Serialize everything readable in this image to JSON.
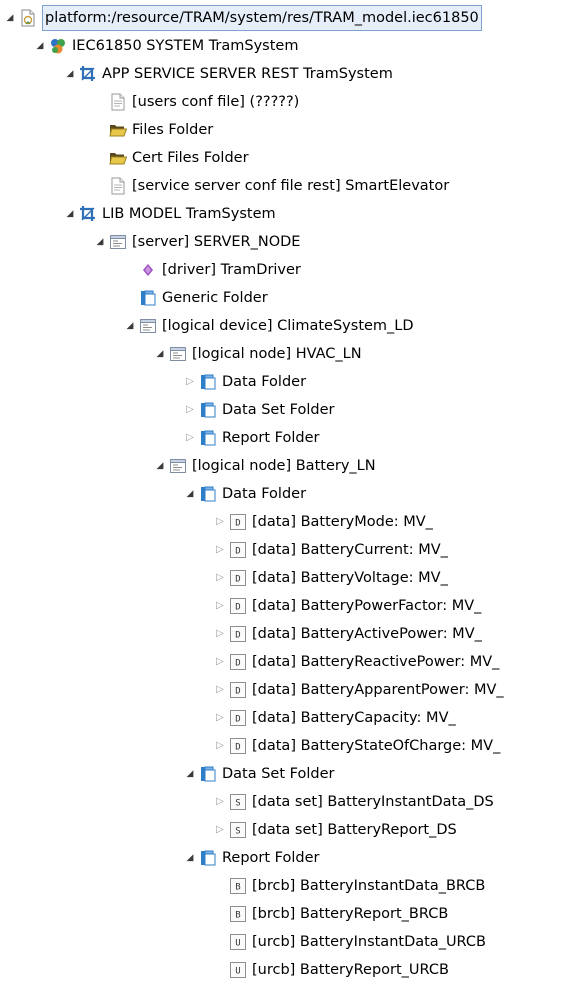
{
  "tree": [
    {
      "id": "resource",
      "depth": 0,
      "label": "platform:/resource/TRAM/system/res/TRAM_model.iec61850",
      "icon": "resource-file-icon",
      "twisty": "expanded",
      "selected": true
    },
    {
      "id": "system",
      "depth": 1,
      "label": "IEC61850 SYSTEM TramSystem",
      "icon": "system-icon",
      "twisty": "expanded"
    },
    {
      "id": "app-service",
      "depth": 2,
      "label": "APP SERVICE SERVER REST TramSystem",
      "icon": "crop-icon",
      "twisty": "expanded"
    },
    {
      "id": "users-conf",
      "depth": 3,
      "label": "[users conf file] (?????)",
      "icon": "document-icon",
      "twisty": "none"
    },
    {
      "id": "files-folder",
      "depth": 3,
      "label": "Files Folder",
      "icon": "open-folder-icon",
      "twisty": "none"
    },
    {
      "id": "cert-files-folder",
      "depth": 3,
      "label": "Cert Files Folder",
      "icon": "open-folder-icon",
      "twisty": "none"
    },
    {
      "id": "service-conf",
      "depth": 3,
      "label": "[service server conf file rest] SmartElevator",
      "icon": "document-icon",
      "twisty": "none"
    },
    {
      "id": "lib-model",
      "depth": 2,
      "label": "LIB MODEL TramSystem",
      "icon": "crop-icon",
      "twisty": "expanded"
    },
    {
      "id": "server-node",
      "depth": 3,
      "label": "[server] SERVER_NODE",
      "icon": "window-icon",
      "twisty": "expanded"
    },
    {
      "id": "driver",
      "depth": 4,
      "label": "[driver] TramDriver",
      "icon": "diamond-icon",
      "twisty": "none"
    },
    {
      "id": "generic-folder",
      "depth": 4,
      "label": "Generic Folder",
      "icon": "blue-folder-icon",
      "twisty": "none"
    },
    {
      "id": "logical-device",
      "depth": 4,
      "label": "[logical device] ClimateSystem_LD",
      "icon": "window-icon",
      "twisty": "expanded"
    },
    {
      "id": "hvac-ln",
      "depth": 5,
      "label": "[logical node] HVAC_LN",
      "icon": "window-icon",
      "twisty": "expanded"
    },
    {
      "id": "hvac-data",
      "depth": 6,
      "label": "Data Folder",
      "icon": "blue-folder-icon",
      "twisty": "collapsed"
    },
    {
      "id": "hvac-dataset",
      "depth": 6,
      "label": "Data Set Folder",
      "icon": "blue-folder-icon",
      "twisty": "collapsed"
    },
    {
      "id": "hvac-report",
      "depth": 6,
      "label": "Report Folder",
      "icon": "blue-folder-icon",
      "twisty": "collapsed"
    },
    {
      "id": "battery-ln",
      "depth": 5,
      "label": "[logical node] Battery_LN",
      "icon": "window-icon",
      "twisty": "expanded"
    },
    {
      "id": "battery-data",
      "depth": 6,
      "label": "Data Folder",
      "icon": "blue-folder-icon",
      "twisty": "expanded"
    },
    {
      "id": "battery-mode",
      "depth": 7,
      "label": "[data] BatteryMode: MV_",
      "icon": "letter-d-icon",
      "twisty": "collapsed"
    },
    {
      "id": "battery-current",
      "depth": 7,
      "label": "[data] BatteryCurrent: MV_",
      "icon": "letter-d-icon",
      "twisty": "collapsed"
    },
    {
      "id": "battery-voltage",
      "depth": 7,
      "label": "[data] BatteryVoltage: MV_",
      "icon": "letter-d-icon",
      "twisty": "collapsed"
    },
    {
      "id": "battery-powerfactor",
      "depth": 7,
      "label": "[data] BatteryPowerFactor: MV_",
      "icon": "letter-d-icon",
      "twisty": "collapsed"
    },
    {
      "id": "battery-activepower",
      "depth": 7,
      "label": "[data] BatteryActivePower: MV_",
      "icon": "letter-d-icon",
      "twisty": "collapsed"
    },
    {
      "id": "battery-reactivepower",
      "depth": 7,
      "label": "[data] BatteryReactivePower: MV_",
      "icon": "letter-d-icon",
      "twisty": "collapsed"
    },
    {
      "id": "battery-apparentpower",
      "depth": 7,
      "label": "[data] BatteryApparentPower: MV_",
      "icon": "letter-d-icon",
      "twisty": "collapsed"
    },
    {
      "id": "battery-capacity",
      "depth": 7,
      "label": "[data] BatteryCapacity: MV_",
      "icon": "letter-d-icon",
      "twisty": "collapsed"
    },
    {
      "id": "battery-soc",
      "depth": 7,
      "label": "[data] BatteryStateOfCharge: MV_",
      "icon": "letter-d-icon",
      "twisty": "collapsed"
    },
    {
      "id": "battery-dataset-folder",
      "depth": 6,
      "label": "Data Set Folder",
      "icon": "blue-folder-icon",
      "twisty": "expanded"
    },
    {
      "id": "ds-instant",
      "depth": 7,
      "label": "[data set] BatteryInstantData_DS",
      "icon": "letter-s-icon",
      "twisty": "collapsed"
    },
    {
      "id": "ds-report",
      "depth": 7,
      "label": "[data set] BatteryReport_DS",
      "icon": "letter-s-icon",
      "twisty": "collapsed"
    },
    {
      "id": "battery-report-folder",
      "depth": 6,
      "label": "Report Folder",
      "icon": "blue-folder-icon",
      "twisty": "expanded"
    },
    {
      "id": "brcb-instant",
      "depth": 7,
      "label": "[brcb] BatteryInstantData_BRCB",
      "icon": "letter-b-icon",
      "twisty": "none"
    },
    {
      "id": "brcb-report",
      "depth": 7,
      "label": "[brcb] BatteryReport_BRCB",
      "icon": "letter-b-icon",
      "twisty": "none"
    },
    {
      "id": "urcb-instant",
      "depth": 7,
      "label": "[urcb] BatteryInstantData_URCB",
      "icon": "letter-u-icon",
      "twisty": "none"
    },
    {
      "id": "urcb-report",
      "depth": 7,
      "label": "[urcb] BatteryReport_URCB",
      "icon": "letter-u-icon",
      "twisty": "none"
    }
  ],
  "colors": {
    "selection_border": "#7da2ce",
    "selection_fill": "#e6eef9",
    "folder_blue": "#2f7fc8",
    "folder_yellow": "#e8c84a",
    "system_green": "#3fa34d",
    "system_blue": "#2f72c4",
    "system_orange": "#e8892f",
    "diamond_purple": "#9c4fc0"
  }
}
